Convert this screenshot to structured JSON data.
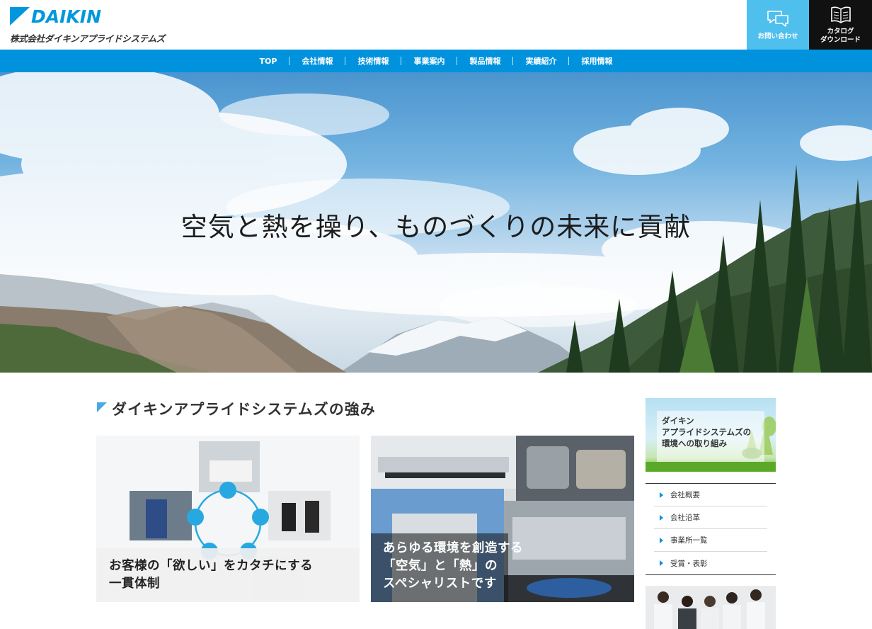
{
  "brand": {
    "logo_word": "DAIKIN",
    "company_name": "株式会社ダイキンアプライドシステムズ",
    "color_primary": "#0092dd",
    "color_light": "#4fbfee"
  },
  "header_buttons": {
    "contact_label": "お問い合わせ",
    "contact_icon": "chat-bubbles-icon",
    "catalog_line1": "カタログ",
    "catalog_line2": "ダウンロード",
    "catalog_icon": "book-icon"
  },
  "nav": {
    "items": [
      {
        "label": "TOP"
      },
      {
        "label": "会社情報"
      },
      {
        "label": "技術情報"
      },
      {
        "label": "事業案内"
      },
      {
        "label": "製品情報"
      },
      {
        "label": "実績紹介"
      },
      {
        "label": "採用情報"
      }
    ]
  },
  "hero": {
    "copy": "空気と熱を操り、ものづくりの未来に貢献"
  },
  "strengths": {
    "title": "ダイキンアプライドシステムズの強み",
    "cards": [
      {
        "line1": "お客様の「欲しい」をカタチにする",
        "line2": "一貫体制"
      },
      {
        "line1": "あらゆる環境を創造する",
        "line2": "「空気」と「熱」の",
        "line3": "スペシャリストです"
      }
    ]
  },
  "sidebar": {
    "eco_banner": {
      "line1": "ダイキン",
      "line2": "アプライドシステムズの",
      "line3": "環境への取り組み"
    },
    "menu": [
      {
        "label": "会社概要"
      },
      {
        "label": "会社沿革"
      },
      {
        "label": "事業所一覧"
      },
      {
        "label": "受賞・表彰"
      }
    ]
  }
}
